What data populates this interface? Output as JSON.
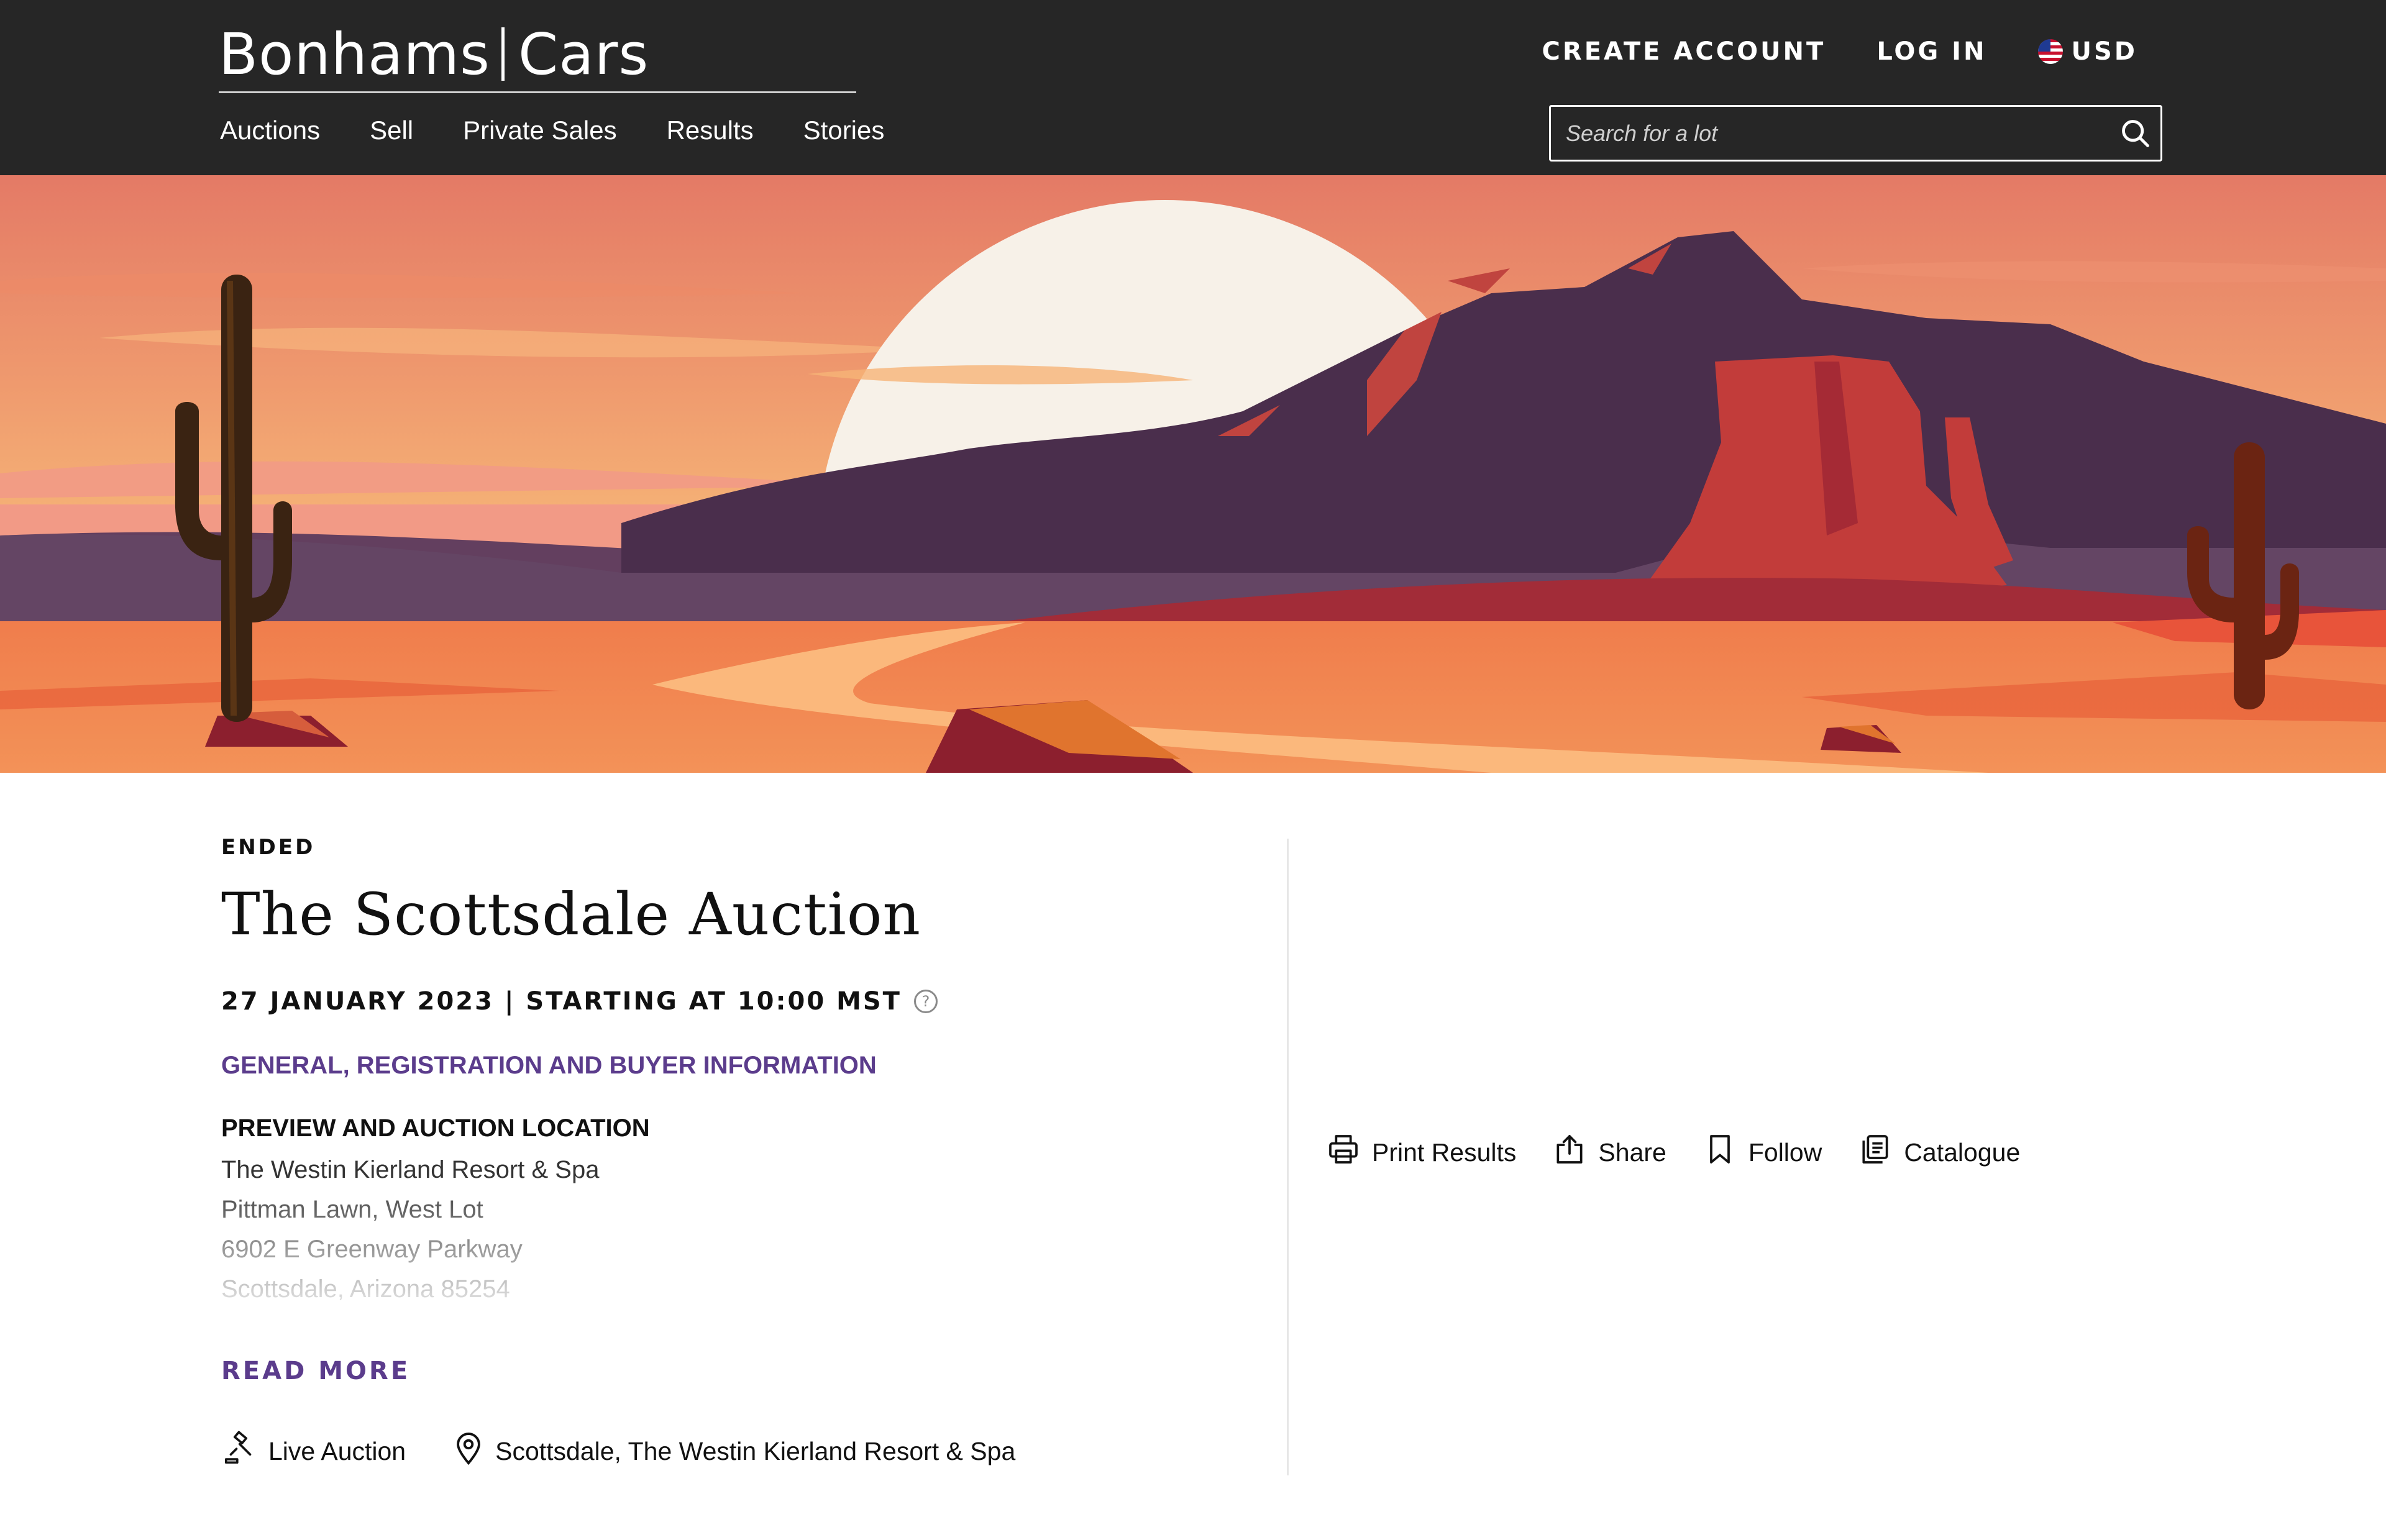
{
  "header": {
    "logo_left": "Bonhams",
    "logo_right": "Cars",
    "nav": [
      "Auctions",
      "Sell",
      "Private Sales",
      "Results",
      "Stories"
    ],
    "create_account": "CREATE ACCOUNT",
    "log_in": "LOG IN",
    "currency": "USD",
    "search_placeholder": "Search for a lot"
  },
  "hero": {
    "colors": {
      "sky": "#e9876a",
      "sun": "#f7f1e8",
      "mountain": "#4a2e4c",
      "mesa": "#c23c3a",
      "sand": "#f0844d"
    }
  },
  "auction": {
    "status": "ENDED",
    "title": "The Scottsdale Auction",
    "datetime": "27 JANUARY 2023 | STARTING AT 10:00 MST",
    "info_link": "GENERAL, REGISTRATION AND BUYER INFORMATION",
    "location_heading": "PREVIEW AND AUCTION LOCATION",
    "address": [
      "The Westin Kierland Resort & Spa",
      "Pittman Lawn, West Lot",
      "6902 E Greenway Parkway",
      "Scottsdale, Arizona 85254"
    ],
    "read_more": "READ MORE",
    "auction_type": "Live Auction",
    "venue": "Scottsdale, The Westin Kierland Resort & Spa"
  },
  "actions": {
    "print": "Print Results",
    "share": "Share",
    "follow": "Follow",
    "catalogue": "Catalogue"
  },
  "colors": {
    "header_bg": "#262626",
    "accent_purple": "#5b3c8c"
  }
}
